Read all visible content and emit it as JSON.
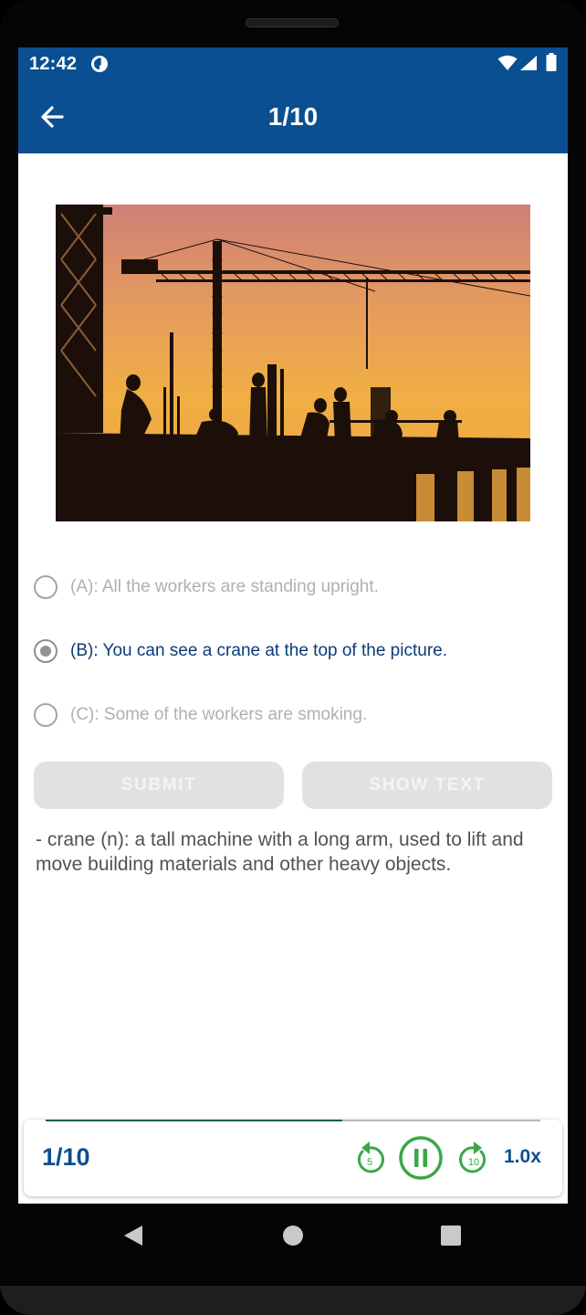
{
  "status_bar": {
    "time": "12:42",
    "icons": [
      "notification-icon",
      "wifi-icon",
      "signal-icon",
      "battery-icon"
    ]
  },
  "app_bar": {
    "title": "1/10",
    "back_icon": "arrow-back-icon",
    "background_color": "#0a4f91"
  },
  "question": {
    "image_description": "construction-site-silhouette",
    "options": [
      {
        "label": "(A): All the workers are standing upright.",
        "selected": false
      },
      {
        "label": "(B): You can see a crane at the top of the picture.",
        "selected": true
      },
      {
        "label": "(C): Some of the workers are smoking.",
        "selected": false
      }
    ]
  },
  "buttons": {
    "submit_label": "SUBMIT",
    "show_text_label": "SHOW TEXT"
  },
  "definition": {
    "text": "- crane (n): a tall machine with a long arm, used to lift and move building materials and other heavy objects."
  },
  "player": {
    "count": "1/10",
    "progress_fraction": 0.6,
    "rewind_seconds": "5",
    "forward_seconds": "10",
    "speed": "1.0x",
    "accent_color": "#3aa845",
    "text_color": "#0a4f91"
  },
  "nav_bar": {
    "icons": [
      "back-triangle-icon",
      "home-circle-icon",
      "recents-square-icon"
    ]
  }
}
